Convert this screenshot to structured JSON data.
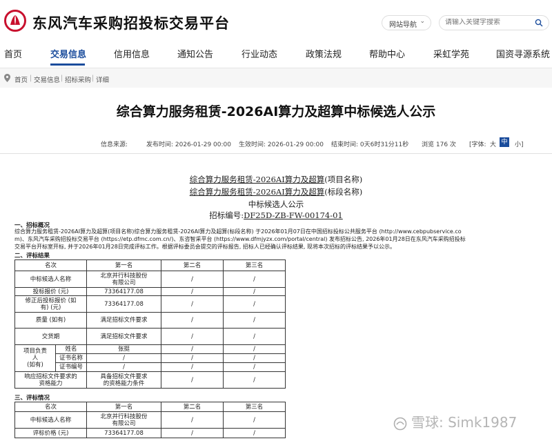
{
  "header": {
    "site_title": "东风汽车采购招投标交易平台",
    "nav_dropdown_label": "网站导航",
    "search_placeholder": "请输入关键字搜索"
  },
  "mainnav": {
    "items": [
      "首页",
      "交易信息",
      "信用信息",
      "通知公告",
      "行业动态",
      "政策法规",
      "帮助中心",
      "采虹学苑",
      "国资寻源系统"
    ],
    "active": "交易信息"
  },
  "breadcrumb": [
    "首页",
    "交易信息",
    "招标采购",
    "详细"
  ],
  "page_title": "综合算力服务租赁-2026AI算力及超算中标候选人公示",
  "info": {
    "source": "信息来源:",
    "publish_time": "发布时间: 2026-01-29 00:00",
    "effective_time": "生效时间: 2026-01-29 00:00",
    "end_time": "结束时间: 0天6时31分11秒",
    "views": "浏览 176 次",
    "font_label": "[字体:",
    "font_large": "大",
    "font_medium": "中",
    "font_small": "小]"
  },
  "doc": {
    "project_name": "综合算力服务租赁-2026AI算力及超算",
    "project_suffix": "(项目名称)",
    "section_name": "综合算力服务租赁-2026AI算力及超算",
    "section_suffix": "(标段名称)",
    "notice_title": "中标候选人公示",
    "bid_no_label": "招标编号:",
    "bid_no": "DF25D-ZB-FW-00174-01",
    "h1": "一、招标概况",
    "p1_line1": "综合算力服务租赁-2026AI算力及超算(项目名称)综合算力服务租赁-2026AI算力及超算(标段名称) 于2026年01月07日在中国招标投标公共服务平台 (http://www.cebpubservice.co",
    "p1_line2": "m)、东风汽车采购招投标交易平台 (https://etp.dfmc.com.cn/)、东咨智采平台 (https://www.dfmjyzx.com/portal/central) 发布招标公告, 2026年01月28日在东风汽车采购招投标",
    "p1_line3": "交易平台开标室开标, 并于2026年01月28日完成评标工作。根据评标委员会提交的评标报告, 招标人已经确认评标结果, 现将本次招标的评标结果予以公示。",
    "h2": "二、评标结果",
    "h3": "三、评标情况",
    "table1": {
      "headers": [
        "名次",
        "第一名",
        "第二名",
        "第三名"
      ],
      "candidate_label": "中标候选人名称",
      "candidate": [
        "北京并行科技股份",
        "有限公司"
      ],
      "price_label": "投标报价 (元)",
      "price": "73364177.08",
      "revised_label": [
        "修正后投标报价 (如",
        "有) (元)"
      ],
      "revised": "73364177.08",
      "quality_label": "质量 (如有)",
      "quality": "满足招标文件要求",
      "delivery_label": "交货期",
      "delivery": "满足招标文件要求",
      "pm_label": [
        "项目负责",
        "人",
        "(如有)"
      ],
      "pm_name_label": "姓名",
      "pm_name": "张挺",
      "cert_name_label": "证书名称",
      "cert_no_label": "证书编号",
      "capability_label": [
        "响应招标文件要求的",
        "资格能力"
      ],
      "capability": [
        "具备招标文件要求",
        "的资格能力条件"
      ],
      "slash": "/"
    },
    "table2": {
      "headers": [
        "名次",
        "第一名",
        "第二名",
        "第三名"
      ],
      "candidate_label": "中标候选人名称",
      "candidate": [
        "北京并行科技股份",
        "有限公司"
      ],
      "price_label": "评标价格 (元)",
      "price": "73364177.08",
      "slash": "/"
    }
  },
  "watermark": "雪球: Simk1987",
  "colors": {
    "brand": "#c8102e",
    "accent": "#1a4c9c"
  }
}
